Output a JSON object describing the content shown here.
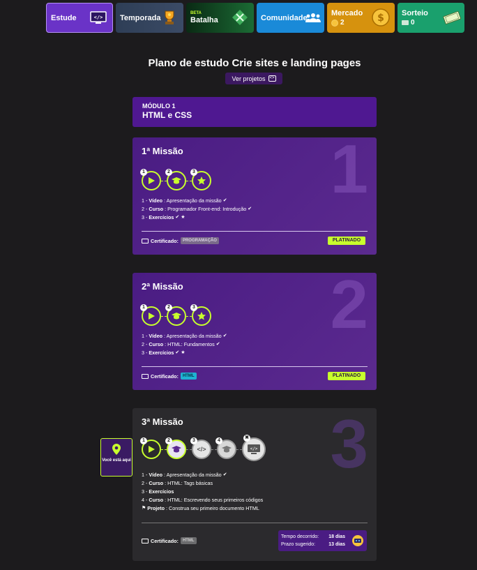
{
  "nav": {
    "estude": "Estude",
    "temporada": "Temporada",
    "batalha_beta": "BETA",
    "batalha": "Batalha",
    "comunidade": "Comunidade",
    "mercado": "Mercado",
    "mercado_coins": "2",
    "sorteio": "Sorteio",
    "sorteio_tickets": "0"
  },
  "plan": {
    "title": "Plano de estudo Crie sites e landing pages",
    "ver_projetos": "Ver projetos"
  },
  "module": {
    "label": "MÓDULO 1",
    "name": "HTML e CSS"
  },
  "missions": [
    {
      "title": "1ª Missão",
      "number": "1",
      "items": [
        {
          "idx": "1 -",
          "kind": "Vídeo",
          "text": ": Apresentação da missão"
        },
        {
          "idx": "2 -",
          "kind": "Curso",
          "text": ": Programador Front-end: Introdução"
        },
        {
          "idx": "3 -",
          "kind": "Exercícios",
          "text": ""
        }
      ],
      "cert_label": "Certificado:",
      "cert_tag": "PROGRAMAÇÃO",
      "status": "PLATINADO"
    },
    {
      "title": "2ª Missão",
      "number": "2",
      "items": [
        {
          "idx": "1 -",
          "kind": "Vídeo",
          "text": ": Apresentação da missão"
        },
        {
          "idx": "2 -",
          "kind": "Curso",
          "text": ": HTML: Fundamentos"
        },
        {
          "idx": "3 -",
          "kind": "Exercícios",
          "text": ""
        }
      ],
      "cert_label": "Certificado:",
      "cert_tag": "HTML",
      "status": "PLATINADO"
    },
    {
      "title": "3ª Missão",
      "number": "3",
      "items": [
        {
          "idx": "1 -",
          "kind": "Vídeo",
          "text": ": Apresentação da missão"
        },
        {
          "idx": "2 -",
          "kind": "Curso",
          "text": ": HTML: Tags básicas"
        },
        {
          "idx": "3 -",
          "kind": "Exercícios",
          "text": ""
        },
        {
          "idx": "4 -",
          "kind": "Curso",
          "text": ": HTML: Escrevendo seus primeiros códigos"
        },
        {
          "idx": "",
          "kind": "Projeto",
          "text": ": Construa seu primeiro documento HTML"
        }
      ],
      "cert_label": "Certificado:",
      "cert_tag": "HTML",
      "time_elapsed_label": "Tempo decorrido:",
      "time_elapsed": "18 dias",
      "time_suggested_label": "Prazo sugerido:",
      "time_suggested": "13 dias"
    }
  ],
  "you_here": "Você está aqui",
  "colors": {
    "accent": "#c8ff2d",
    "purple": "#4f1891",
    "bg": "#1c1b1d"
  }
}
